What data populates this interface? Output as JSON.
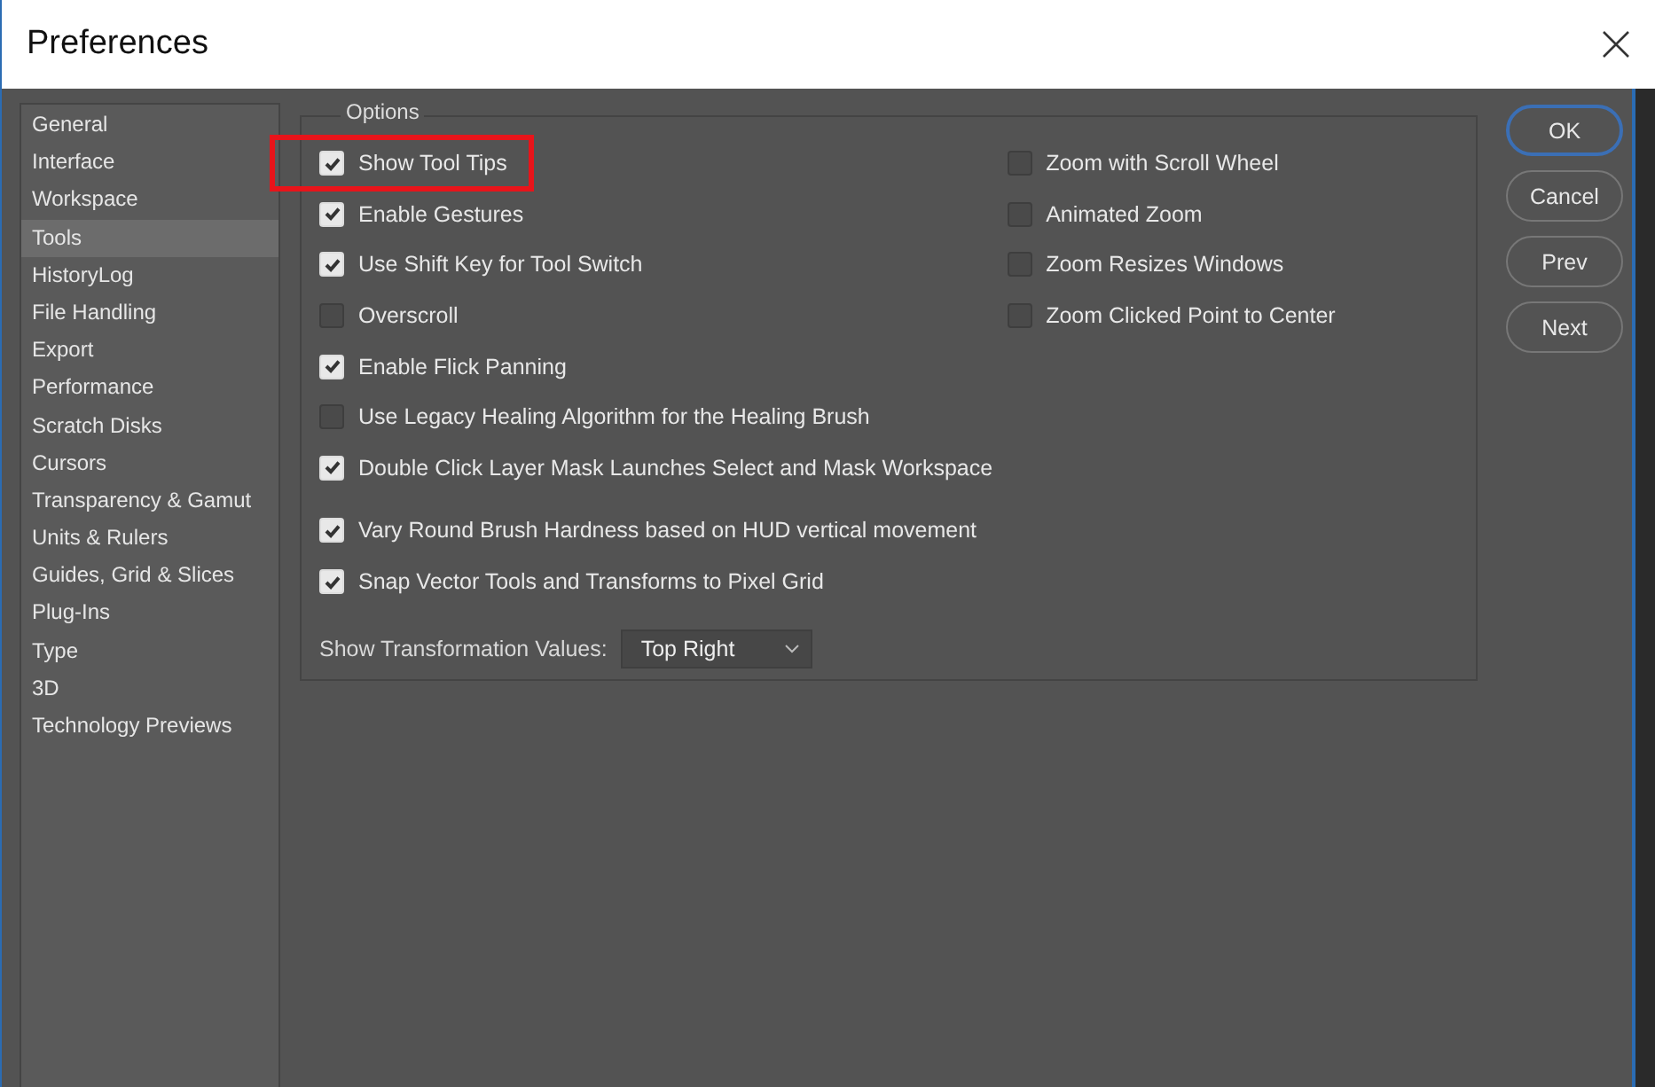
{
  "window": {
    "title": "Preferences"
  },
  "sidebar": {
    "items": [
      {
        "label": "General",
        "selected": false
      },
      {
        "label": "Interface",
        "selected": false
      },
      {
        "label": "Workspace",
        "selected": false
      },
      {
        "label": "Tools",
        "selected": true
      },
      {
        "label": "HistoryLog",
        "selected": false
      },
      {
        "label": "File Handling",
        "selected": false
      },
      {
        "label": "Export",
        "selected": false
      },
      {
        "label": "Performance",
        "selected": false
      },
      {
        "label": "Scratch Disks",
        "selected": false
      },
      {
        "label": "Cursors",
        "selected": false
      },
      {
        "label": "Transparency & Gamut",
        "selected": false
      },
      {
        "label": "Units & Rulers",
        "selected": false
      },
      {
        "label": "Guides, Grid & Slices",
        "selected": false
      },
      {
        "label": "Plug-Ins",
        "selected": false
      },
      {
        "label": "Type",
        "selected": false
      },
      {
        "label": "3D",
        "selected": false
      },
      {
        "label": "Technology Previews",
        "selected": false
      }
    ]
  },
  "options": {
    "legend": "Options",
    "left_groups": [
      [
        {
          "label": "Show Tool Tips",
          "checked": true,
          "highlighted": true
        },
        {
          "label": "Enable Gestures",
          "checked": true,
          "highlighted": false
        },
        {
          "label": "Use Shift Key for Tool Switch",
          "checked": true,
          "highlighted": false
        },
        {
          "label": "Overscroll",
          "checked": false,
          "highlighted": false
        },
        {
          "label": "Enable Flick Panning",
          "checked": true,
          "highlighted": false
        },
        {
          "label": "Use Legacy Healing Algorithm for the Healing Brush",
          "checked": false,
          "highlighted": false
        },
        {
          "label": "Double Click Layer Mask Launches Select and Mask Workspace",
          "checked": true,
          "highlighted": false
        }
      ],
      [
        {
          "label": "Vary Round Brush Hardness based on HUD vertical movement",
          "checked": true,
          "highlighted": false
        },
        {
          "label": "Snap Vector Tools and Transforms to Pixel Grid",
          "checked": true,
          "highlighted": false
        }
      ]
    ],
    "right": [
      {
        "label": "Zoom with Scroll Wheel",
        "checked": false,
        "highlighted": false
      },
      {
        "label": "Animated Zoom",
        "checked": false,
        "highlighted": false
      },
      {
        "label": "Zoom Resizes Windows",
        "checked": false,
        "highlighted": false
      },
      {
        "label": "Zoom Clicked Point to Center",
        "checked": false,
        "highlighted": false
      }
    ],
    "transformation": {
      "label": "Show Transformation Values:",
      "value": "Top Right"
    }
  },
  "buttons": [
    {
      "label": "OK",
      "default": true
    },
    {
      "label": "Cancel",
      "default": false
    },
    {
      "label": "Prev",
      "default": false
    },
    {
      "label": "Next",
      "default": false
    }
  ]
}
